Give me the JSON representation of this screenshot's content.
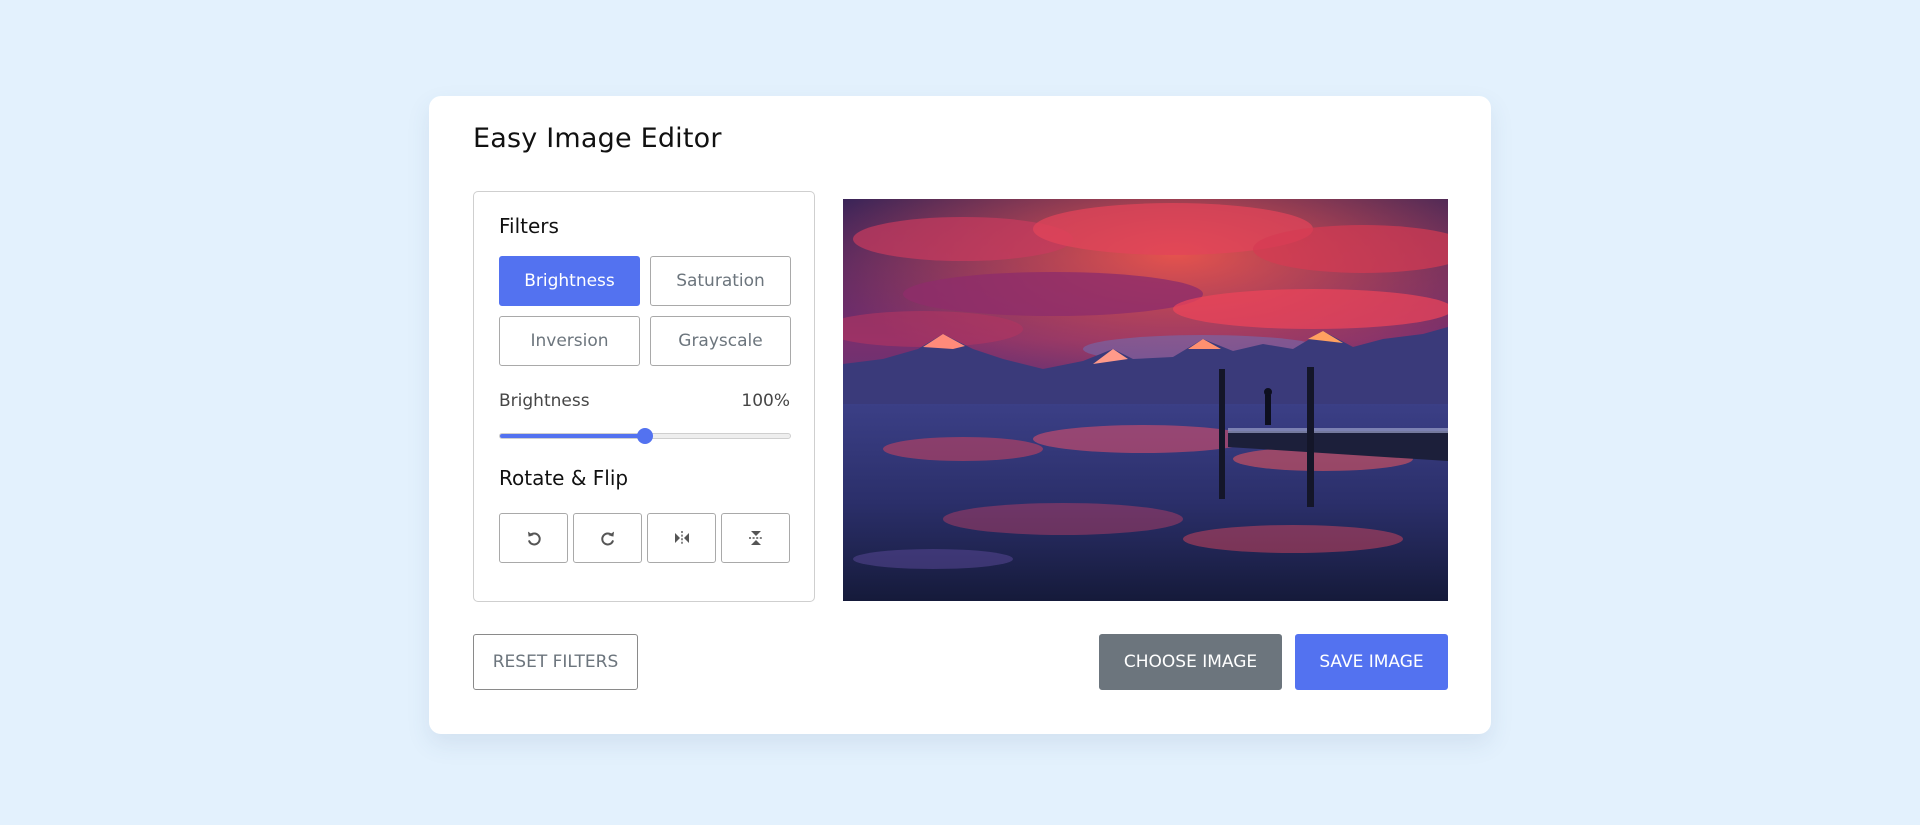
{
  "app": {
    "title": "Easy Image Editor"
  },
  "filters": {
    "heading": "Filters",
    "options": [
      {
        "label": "Brightness",
        "active": true
      },
      {
        "label": "Saturation",
        "active": false
      },
      {
        "label": "Inversion",
        "active": false
      },
      {
        "label": "Grayscale",
        "active": false
      }
    ],
    "slider": {
      "name": "Brightness",
      "value_text": "100%",
      "level_fraction": 0.5
    }
  },
  "rotate": {
    "heading": "Rotate & Flip",
    "buttons": [
      {
        "icon": "rotate-left-icon"
      },
      {
        "icon": "rotate-right-icon"
      },
      {
        "icon": "flip-horizontal-icon"
      },
      {
        "icon": "flip-vertical-icon"
      }
    ]
  },
  "preview": {
    "image": "lake-mountain-sunset-photo"
  },
  "actions": {
    "reset_label": "Reset Filters",
    "choose_label": "Choose Image",
    "save_label": "Save Image"
  },
  "colors": {
    "background": "#E3F1FD",
    "accent": "#5372F0",
    "secondary": "#6C757D"
  }
}
